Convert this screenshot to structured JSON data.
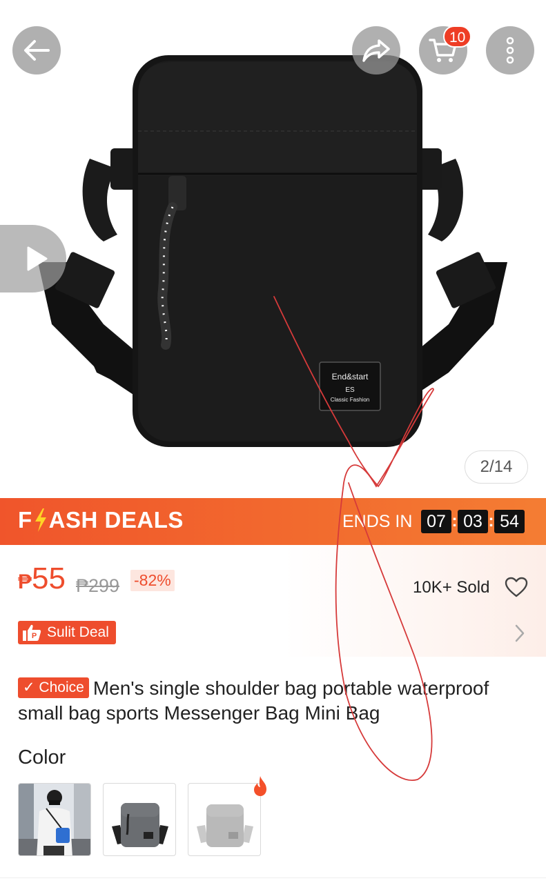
{
  "header": {
    "cart_badge": "10",
    "icons": [
      "back-arrow-icon",
      "share-icon",
      "cart-icon",
      "more-vertical-icon",
      "play-icon"
    ]
  },
  "gallery": {
    "counter": "2/14",
    "patch_line1": "End&start",
    "patch_line2": "ES",
    "patch_line3": "Classic Fashion"
  },
  "flash_deals": {
    "title_prefix": "F",
    "title_suffix": "ASH DEALS",
    "ends_in_label": "ENDS IN",
    "hours": "07",
    "minutes": "03",
    "seconds": "54"
  },
  "price": {
    "currency": "₱",
    "current": "55",
    "original": "₱299",
    "discount": "-82%",
    "sold": "10K+ Sold",
    "sulit_label": "Sulit Deal"
  },
  "product": {
    "choice_label": "✓ Choice",
    "title": "Men's single shoulder bag portable waterproof small bag sports Messenger Bag Mini Bag"
  },
  "variants": {
    "label": "Color"
  },
  "colors": {
    "brand": "#ee4d2d",
    "flash_bar": "#f26a2e",
    "badge": "#ee3d25"
  }
}
